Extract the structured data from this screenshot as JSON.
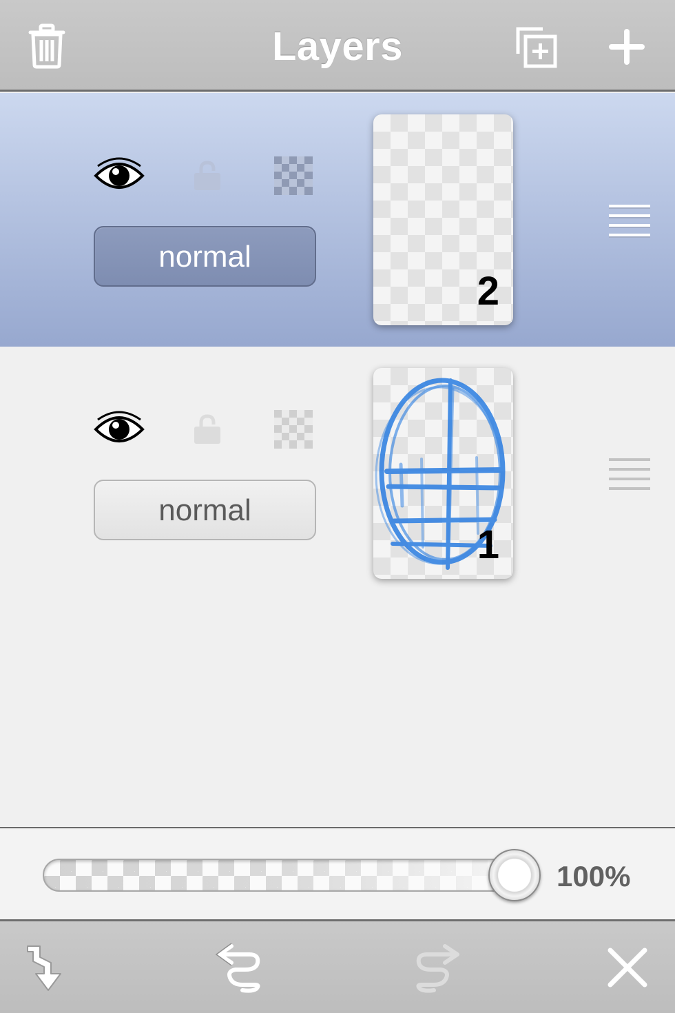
{
  "header": {
    "title": "Layers",
    "icons": [
      "trash-icon",
      "duplicate-layer-icon",
      "plus-icon"
    ]
  },
  "layers": [
    {
      "number": "2",
      "blend_mode": "normal",
      "selected": true,
      "visible": true,
      "locked": false,
      "icons": [
        "eye-icon",
        "lock-icon",
        "alpha-lock-icon",
        "reorder-handle-icon"
      ]
    },
    {
      "number": "1",
      "blend_mode": "normal",
      "selected": false,
      "visible": true,
      "locked": false,
      "icons": [
        "eye-icon",
        "lock-icon",
        "alpha-lock-icon",
        "reorder-handle-icon"
      ]
    }
  ],
  "opacity": {
    "label": "100%",
    "fraction": 1.0
  },
  "toolbar": {
    "icons": [
      "merge-down-icon",
      "undo-icon",
      "redo-icon",
      "close-icon"
    ]
  },
  "colors": {
    "selected_row_top": "#ccd8ef",
    "selected_row_bottom": "#97a8cf",
    "sketch_stroke": "#2a7de1",
    "bar": "#c4c4c4"
  }
}
